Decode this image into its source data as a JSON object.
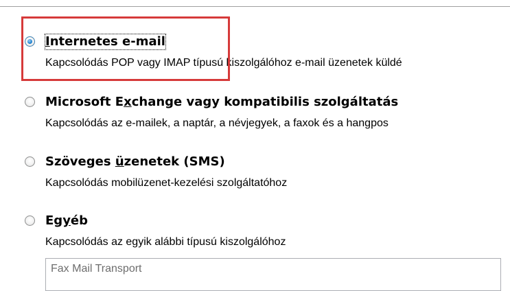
{
  "options": [
    {
      "title_pre": "",
      "title_mnemonic": "I",
      "title_post": "nternetes e-mail",
      "description": "Kapcsolódás POP vagy IMAP típusú kiszolgálóhoz e-mail üzenetek küldé",
      "checked": true,
      "focused": true
    },
    {
      "title_pre": "Microsoft E",
      "title_mnemonic": "x",
      "title_post": "change vagy kompatibilis szolgáltatás",
      "description": "Kapcsolódás az e-mailek, a naptár, a névjegyek, a faxok és a hangpos",
      "checked": false,
      "focused": false
    },
    {
      "title_pre": "Szöveges ",
      "title_mnemonic": "ü",
      "title_post": "zenetek (SMS)",
      "description": "Kapcsolódás mobilüzenet-kezelési szolgáltatóhoz",
      "checked": false,
      "focused": false
    },
    {
      "title_pre": "Eg",
      "title_mnemonic": "y",
      "title_post": "éb",
      "description": "Kapcsolódás az egyik alábbi típusú kiszolgálóhoz",
      "checked": false,
      "focused": false
    }
  ],
  "other_server_types": {
    "items": [
      "Fax Mail Transport"
    ]
  },
  "colors": {
    "highlight": "#d63a3a",
    "placeholder_text": "#6d6d6d",
    "radio_selected": "#1e78c8"
  }
}
